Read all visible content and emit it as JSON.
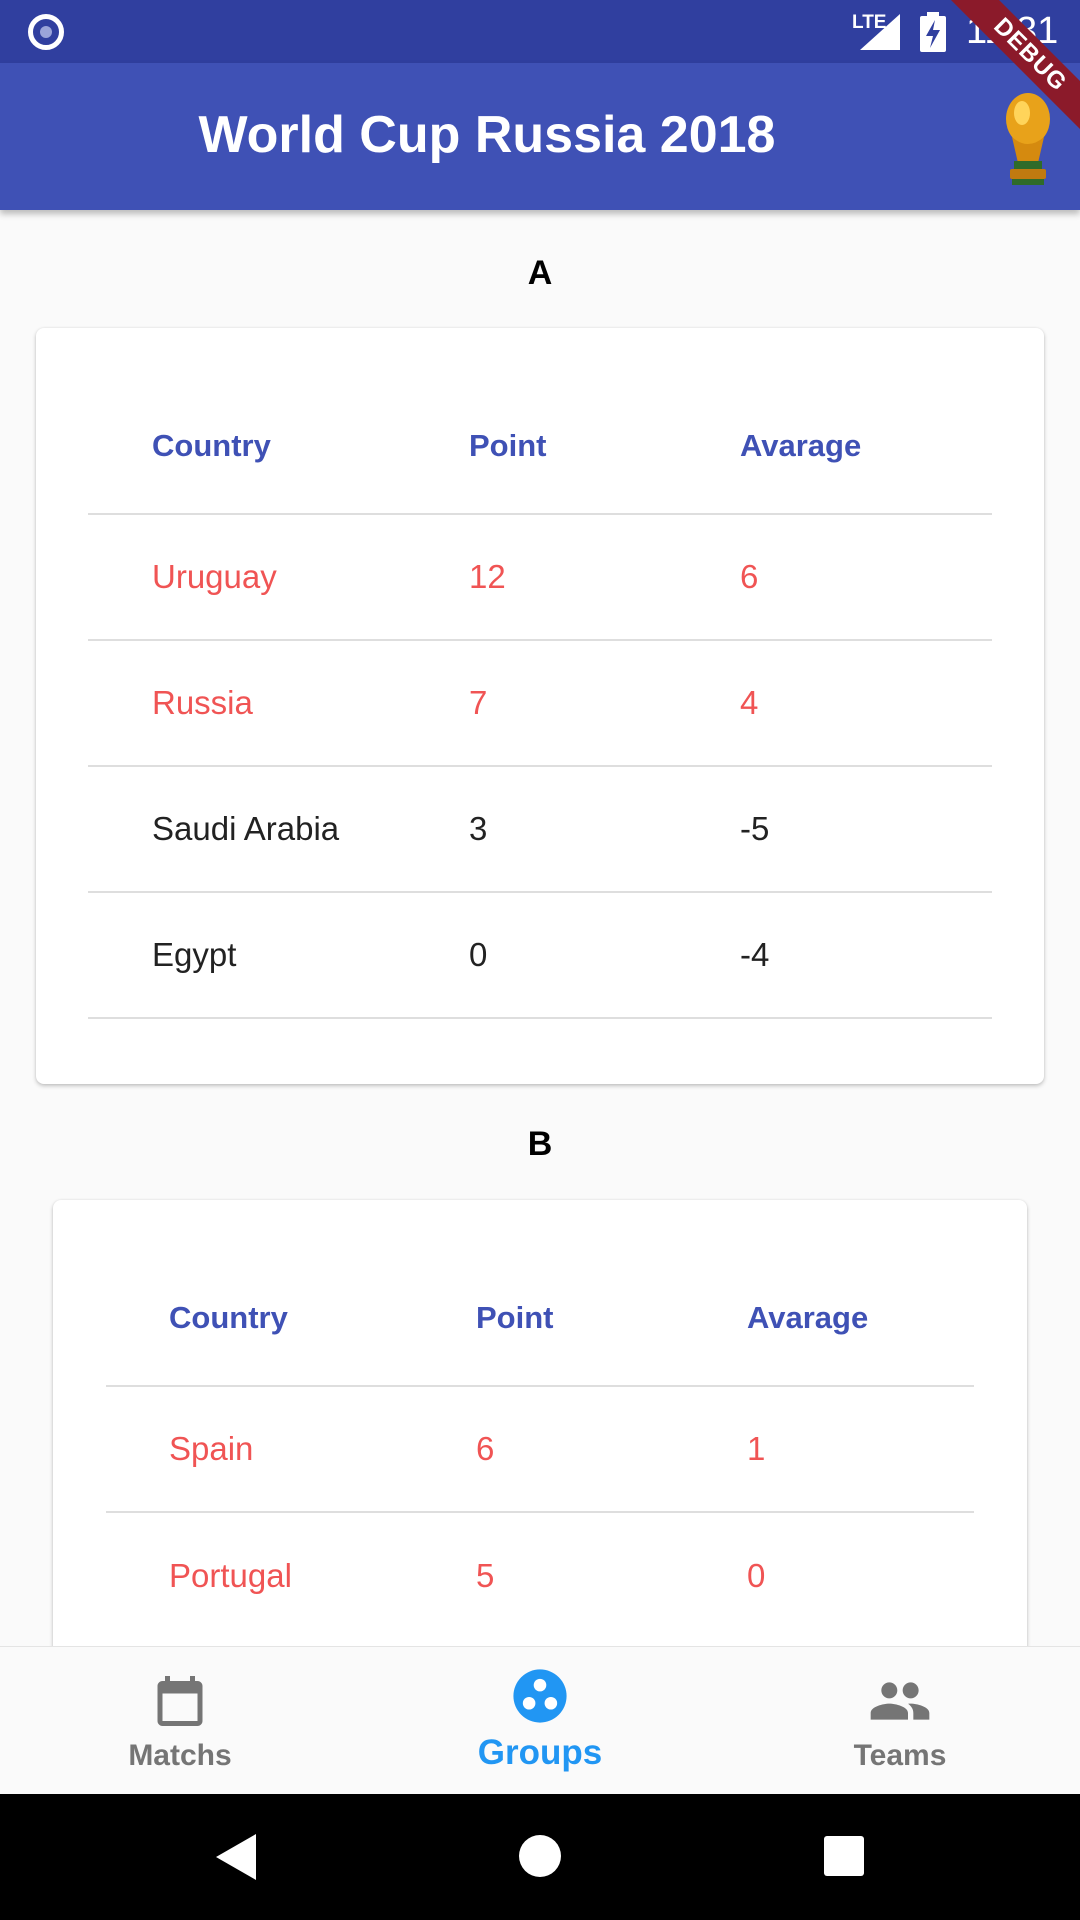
{
  "status_bar": {
    "network": "LTE",
    "time": "11:31"
  },
  "app_bar": {
    "title": "World Cup Russia 2018",
    "trophy_icon": "trophy-icon",
    "debug_banner": "DEBUG"
  },
  "colors": {
    "primary": "#3f51b5",
    "primary_dark": "#303f9f",
    "qualified": "#f05454",
    "active_tab": "#2196f3",
    "inactive_tab": "#757575"
  },
  "groups": [
    {
      "name": "A",
      "columns": [
        "Country",
        "Point",
        "Avarage"
      ],
      "rows": [
        {
          "country": "Uruguay",
          "point": "12",
          "average": "6"
        },
        {
          "country": "Russia",
          "point": "7",
          "average": "4"
        },
        {
          "country": "Saudi Arabia",
          "point": "3",
          "average": "-5"
        },
        {
          "country": "Egypt",
          "point": "0",
          "average": "-4"
        }
      ]
    },
    {
      "name": "B",
      "columns": [
        "Country",
        "Point",
        "Avarage"
      ],
      "rows": [
        {
          "country": "Spain",
          "point": "6",
          "average": "1"
        },
        {
          "country": "Portugal",
          "point": "5",
          "average": "0"
        }
      ]
    }
  ],
  "bottom_nav": {
    "items": [
      {
        "label": "Matchs",
        "icon": "calendar-icon"
      },
      {
        "label": "Groups",
        "icon": "groups-icon"
      },
      {
        "label": "Teams",
        "icon": "people-icon"
      }
    ],
    "active": "Groups"
  },
  "system_nav": {
    "back_icon": "back-icon",
    "home_icon": "home-icon",
    "recents_icon": "recents-icon"
  }
}
